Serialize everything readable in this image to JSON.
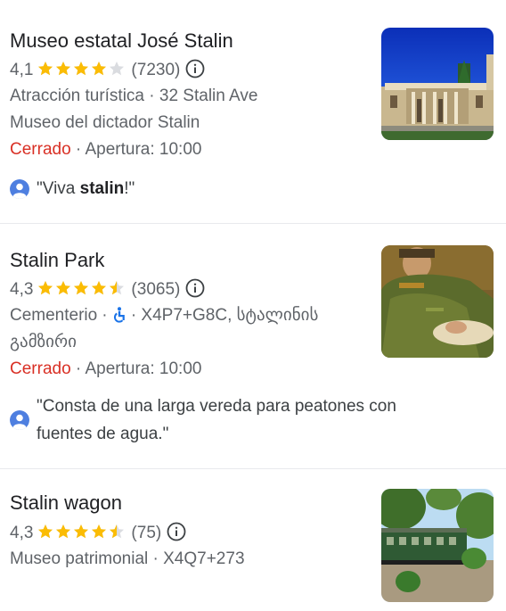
{
  "colors": {
    "star": "#fbbc04",
    "star_empty": "#dadce0",
    "closed": "#d93025",
    "wheelchair": "#1a73e8"
  },
  "results": [
    {
      "title": "Museo estatal José Stalin",
      "rating": "4,1",
      "stars": 4.1,
      "reviews": "(7230)",
      "line1": "Atracción turística · 32 Stalin Ave",
      "line2": "Museo del dictador Stalin",
      "status": "Cerrado",
      "hours": " · Apertura: 10:00",
      "review_pre": "\"Viva ",
      "review_bold": "stalin",
      "review_post": "!\""
    },
    {
      "title": "Stalin Park",
      "rating": "4,3",
      "stars": 4.3,
      "reviews": "(3065)",
      "category": "Cementerio",
      "plus_code": " · X4P7+G8C, სტალინის",
      "address_cont": "გამზირი",
      "status": "Cerrado",
      "hours": " · Apertura: 10:00",
      "review_line1": "\"Consta de una larga vereda para peatones con",
      "review_line2": "fuentes de agua.\""
    },
    {
      "title": "Stalin wagon",
      "rating": "4,3",
      "stars": 4.3,
      "reviews": "(75)",
      "line1": "Museo patrimonial · X4Q7+273"
    }
  ]
}
